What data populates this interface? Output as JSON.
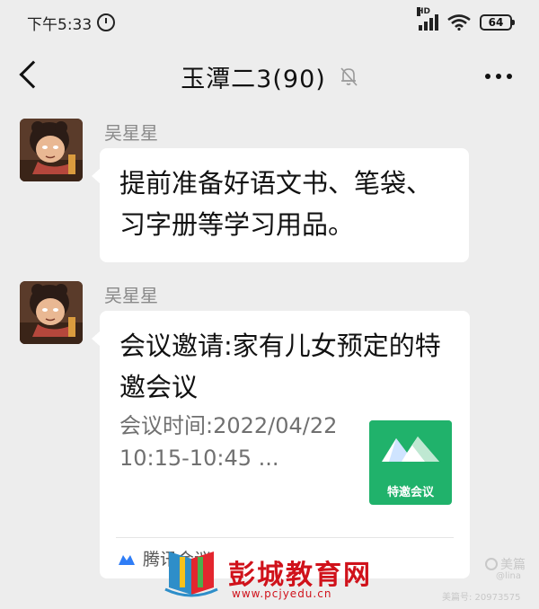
{
  "status_bar": {
    "time": "下午5:33",
    "network_label": "HD",
    "battery": "64"
  },
  "header": {
    "title": "玉潭二3(90)",
    "icons": {
      "back": "chevron-left-icon",
      "mute": "bell-muted-icon",
      "more": "more-dots-icon"
    }
  },
  "messages": [
    {
      "sender": "吴星星",
      "type": "text",
      "text": "提前准备好语文书、笔袋、习字册等学习用品。"
    },
    {
      "sender": "吴星星",
      "type": "card",
      "card_title": "会议邀请:家有儿女预定的特邀会议",
      "card_description": "会议时间:2022/04/22 10:15-10:45 ...",
      "thumbnail_label": "特邀会议",
      "footer_source": "腾讯会议"
    }
  ],
  "watermark": {
    "site_name": "彭城教育网",
    "site_url": "www.pcjyedu.cn",
    "meipian_brand": "美篇",
    "meipian_user": "@lina",
    "meipian_id": "美篇号: 20973575"
  },
  "colors": {
    "background": "#ededed",
    "bubble": "#ffffff",
    "meeting_green": "#20b26b",
    "meeting_blue": "#2f7df6",
    "watermark_red": "#d0121b"
  }
}
